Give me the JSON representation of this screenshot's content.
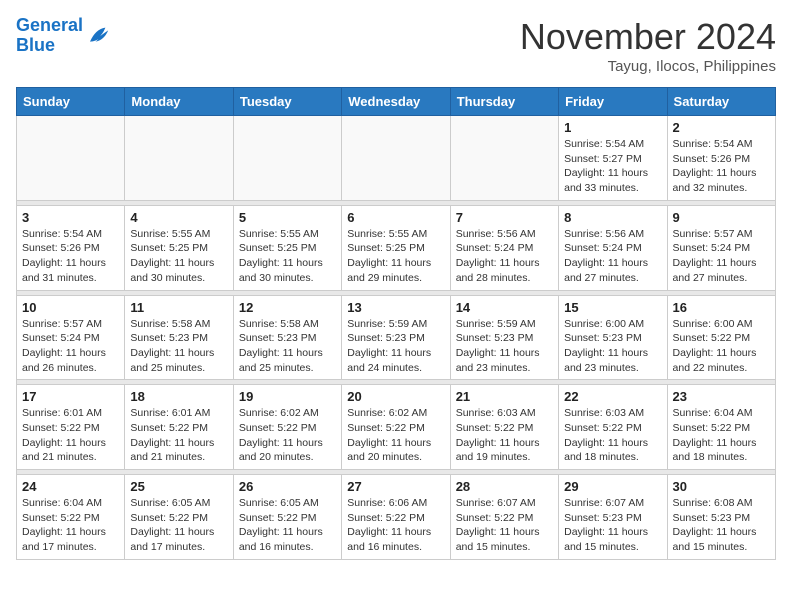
{
  "header": {
    "logo_line1": "General",
    "logo_line2": "Blue",
    "month": "November 2024",
    "location": "Tayug, Ilocos, Philippines"
  },
  "weekdays": [
    "Sunday",
    "Monday",
    "Tuesday",
    "Wednesday",
    "Thursday",
    "Friday",
    "Saturday"
  ],
  "weeks": [
    [
      {
        "day": "",
        "info": ""
      },
      {
        "day": "",
        "info": ""
      },
      {
        "day": "",
        "info": ""
      },
      {
        "day": "",
        "info": ""
      },
      {
        "day": "",
        "info": ""
      },
      {
        "day": "1",
        "info": "Sunrise: 5:54 AM\nSunset: 5:27 PM\nDaylight: 11 hours\nand 33 minutes."
      },
      {
        "day": "2",
        "info": "Sunrise: 5:54 AM\nSunset: 5:26 PM\nDaylight: 11 hours\nand 32 minutes."
      }
    ],
    [
      {
        "day": "3",
        "info": "Sunrise: 5:54 AM\nSunset: 5:26 PM\nDaylight: 11 hours\nand 31 minutes."
      },
      {
        "day": "4",
        "info": "Sunrise: 5:55 AM\nSunset: 5:25 PM\nDaylight: 11 hours\nand 30 minutes."
      },
      {
        "day": "5",
        "info": "Sunrise: 5:55 AM\nSunset: 5:25 PM\nDaylight: 11 hours\nand 30 minutes."
      },
      {
        "day": "6",
        "info": "Sunrise: 5:55 AM\nSunset: 5:25 PM\nDaylight: 11 hours\nand 29 minutes."
      },
      {
        "day": "7",
        "info": "Sunrise: 5:56 AM\nSunset: 5:24 PM\nDaylight: 11 hours\nand 28 minutes."
      },
      {
        "day": "8",
        "info": "Sunrise: 5:56 AM\nSunset: 5:24 PM\nDaylight: 11 hours\nand 27 minutes."
      },
      {
        "day": "9",
        "info": "Sunrise: 5:57 AM\nSunset: 5:24 PM\nDaylight: 11 hours\nand 27 minutes."
      }
    ],
    [
      {
        "day": "10",
        "info": "Sunrise: 5:57 AM\nSunset: 5:24 PM\nDaylight: 11 hours\nand 26 minutes."
      },
      {
        "day": "11",
        "info": "Sunrise: 5:58 AM\nSunset: 5:23 PM\nDaylight: 11 hours\nand 25 minutes."
      },
      {
        "day": "12",
        "info": "Sunrise: 5:58 AM\nSunset: 5:23 PM\nDaylight: 11 hours\nand 25 minutes."
      },
      {
        "day": "13",
        "info": "Sunrise: 5:59 AM\nSunset: 5:23 PM\nDaylight: 11 hours\nand 24 minutes."
      },
      {
        "day": "14",
        "info": "Sunrise: 5:59 AM\nSunset: 5:23 PM\nDaylight: 11 hours\nand 23 minutes."
      },
      {
        "day": "15",
        "info": "Sunrise: 6:00 AM\nSunset: 5:23 PM\nDaylight: 11 hours\nand 23 minutes."
      },
      {
        "day": "16",
        "info": "Sunrise: 6:00 AM\nSunset: 5:22 PM\nDaylight: 11 hours\nand 22 minutes."
      }
    ],
    [
      {
        "day": "17",
        "info": "Sunrise: 6:01 AM\nSunset: 5:22 PM\nDaylight: 11 hours\nand 21 minutes."
      },
      {
        "day": "18",
        "info": "Sunrise: 6:01 AM\nSunset: 5:22 PM\nDaylight: 11 hours\nand 21 minutes."
      },
      {
        "day": "19",
        "info": "Sunrise: 6:02 AM\nSunset: 5:22 PM\nDaylight: 11 hours\nand 20 minutes."
      },
      {
        "day": "20",
        "info": "Sunrise: 6:02 AM\nSunset: 5:22 PM\nDaylight: 11 hours\nand 20 minutes."
      },
      {
        "day": "21",
        "info": "Sunrise: 6:03 AM\nSunset: 5:22 PM\nDaylight: 11 hours\nand 19 minutes."
      },
      {
        "day": "22",
        "info": "Sunrise: 6:03 AM\nSunset: 5:22 PM\nDaylight: 11 hours\nand 18 minutes."
      },
      {
        "day": "23",
        "info": "Sunrise: 6:04 AM\nSunset: 5:22 PM\nDaylight: 11 hours\nand 18 minutes."
      }
    ],
    [
      {
        "day": "24",
        "info": "Sunrise: 6:04 AM\nSunset: 5:22 PM\nDaylight: 11 hours\nand 17 minutes."
      },
      {
        "day": "25",
        "info": "Sunrise: 6:05 AM\nSunset: 5:22 PM\nDaylight: 11 hours\nand 17 minutes."
      },
      {
        "day": "26",
        "info": "Sunrise: 6:05 AM\nSunset: 5:22 PM\nDaylight: 11 hours\nand 16 minutes."
      },
      {
        "day": "27",
        "info": "Sunrise: 6:06 AM\nSunset: 5:22 PM\nDaylight: 11 hours\nand 16 minutes."
      },
      {
        "day": "28",
        "info": "Sunrise: 6:07 AM\nSunset: 5:22 PM\nDaylight: 11 hours\nand 15 minutes."
      },
      {
        "day": "29",
        "info": "Sunrise: 6:07 AM\nSunset: 5:23 PM\nDaylight: 11 hours\nand 15 minutes."
      },
      {
        "day": "30",
        "info": "Sunrise: 6:08 AM\nSunset: 5:23 PM\nDaylight: 11 hours\nand 15 minutes."
      }
    ]
  ]
}
